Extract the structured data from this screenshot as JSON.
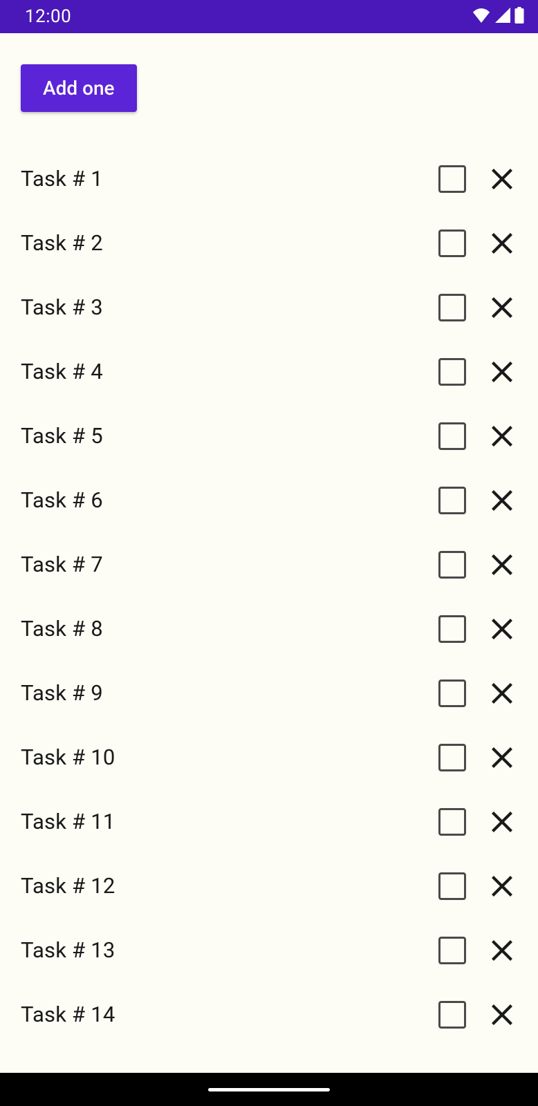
{
  "status": {
    "time": "12:00"
  },
  "header": {
    "add_button_label": "Add one"
  },
  "tasks": [
    {
      "label": "Task # 1",
      "checked": false
    },
    {
      "label": "Task # 2",
      "checked": false
    },
    {
      "label": "Task # 3",
      "checked": false
    },
    {
      "label": "Task # 4",
      "checked": false
    },
    {
      "label": "Task # 5",
      "checked": false
    },
    {
      "label": "Task # 6",
      "checked": false
    },
    {
      "label": "Task # 7",
      "checked": false
    },
    {
      "label": "Task # 8",
      "checked": false
    },
    {
      "label": "Task # 9",
      "checked": false
    },
    {
      "label": "Task # 10",
      "checked": false
    },
    {
      "label": "Task # 11",
      "checked": false
    },
    {
      "label": "Task # 12",
      "checked": false
    },
    {
      "label": "Task # 13",
      "checked": false
    },
    {
      "label": "Task # 14",
      "checked": false
    }
  ]
}
